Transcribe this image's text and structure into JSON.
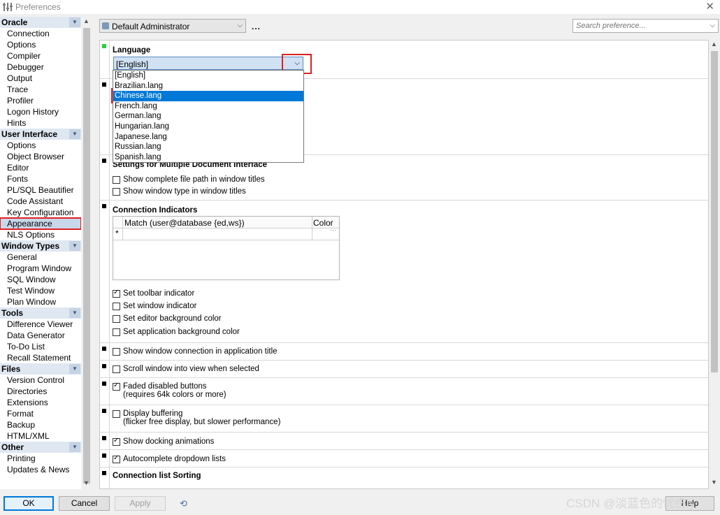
{
  "window": {
    "title": "Preferences"
  },
  "sidebar": {
    "groups": [
      {
        "name": "Oracle",
        "items": [
          "Connection",
          "Options",
          "Compiler",
          "Debugger",
          "Output",
          "Trace",
          "Profiler",
          "Logon History",
          "Hints"
        ]
      },
      {
        "name": "User Interface",
        "items": [
          "Options",
          "Object Browser",
          "Editor",
          "Fonts",
          "PL/SQL Beautifier",
          "Code Assistant",
          "Key Configuration",
          "Appearance",
          "NLS Options"
        ]
      },
      {
        "name": "Window Types",
        "items": [
          "General",
          "Program Window",
          "SQL Window",
          "Test Window",
          "Plan Window"
        ]
      },
      {
        "name": "Tools",
        "items": [
          "Difference Viewer",
          "Data Generator",
          "To-Do List",
          "Recall Statement"
        ]
      },
      {
        "name": "Files",
        "items": [
          "Version Control",
          "Directories",
          "Extensions",
          "Format",
          "Backup",
          "HTML/XML"
        ]
      },
      {
        "name": "Other",
        "items": [
          "Printing",
          "Updates & News"
        ]
      }
    ],
    "selected": "Appearance"
  },
  "toolbar": {
    "profile": "Default Administrator",
    "more": "...",
    "search_placeholder": "Search preference..."
  },
  "language": {
    "heading": "Language",
    "value": "[English]",
    "options": [
      "[English]",
      "Brazilian.lang",
      "Chinese.lang",
      "French.lang",
      "German.lang",
      "Hungarian.lang",
      "Japanese.lang",
      "Russian.lang",
      "Spanish.lang"
    ],
    "highlighted": "Chinese.lang"
  },
  "mdi": {
    "heading": "Settings for Multiple Document Interface",
    "opt1": "Show complete file path in window titles",
    "opt2": "Show window type in window titles"
  },
  "connection_indicators": {
    "heading": "Connection Indicators",
    "col_match": "Match (user@database {ed,ws})",
    "col_color": "Color",
    "new_row_marker": "*",
    "opt_toolbar": "Set toolbar indicator",
    "opt_window": "Set window indicator",
    "opt_editor_bg": "Set editor background color",
    "opt_app_bg": "Set application background color"
  },
  "options": {
    "show_conn_title": "Show window connection in application title",
    "scroll_into_view": "Scroll window into view when selected",
    "faded_buttons": "Faded disabled buttons",
    "faded_buttons_note": "(requires 64k colors or more)",
    "display_buffering": "Display buffering",
    "display_buffering_note": "(flicker free display, but slower performance)",
    "docking_animations": "Show docking animations",
    "autocomplete": "Autocomplete dropdown lists",
    "conn_sorting": "Connection list Sorting"
  },
  "buttons": {
    "ok": "OK",
    "cancel": "Cancel",
    "apply": "Apply",
    "help": "Help"
  },
  "watermark": "CSDN @淡蓝色的忧伤ly"
}
